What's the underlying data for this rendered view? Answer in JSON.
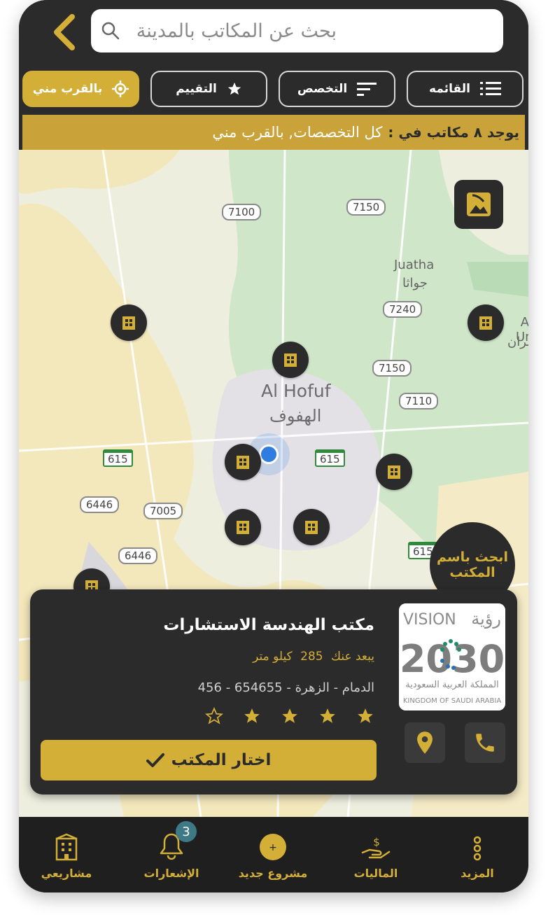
{
  "search": {
    "placeholder": "بحث عن المكاتب بالمدينة"
  },
  "filters": [
    {
      "label": "القائمه"
    },
    {
      "label": "التخصص"
    },
    {
      "label": "التقييم"
    },
    {
      "label": "بالقرب مني"
    }
  ],
  "results": {
    "prefix": "يوجد ٨ مكاتب في :",
    "value": "كل التخصصات, بالقرب مني"
  },
  "map": {
    "search_by_name": "ابحث باسم المكتب",
    "city_en": "Al Hofuf",
    "city_ar": "الهفوف",
    "place_en": "Juatha",
    "place_ar": "جواثا",
    "edge_label_1": "Al Um",
    "edge_label_2": "مران",
    "roads": [
      "7100",
      "7150",
      "7240",
      "7150",
      "7110",
      "615",
      "615",
      "6446",
      "7005",
      "6446",
      "615"
    ]
  },
  "office": {
    "name": "مكتب الهندسة الاستشارات",
    "distance_prefix": "يبعد عنك",
    "distance_value": "285",
    "distance_unit": "كيلو متر",
    "address": "الدمام - الزهرة - 654655 - 456",
    "rating": 4,
    "rating_max": 5,
    "select_label": "اختار المكتب",
    "logo": {
      "vision": "VISION",
      "vision_ar": "رؤية",
      "year": "2030",
      "kingdom_ar": "المملكة العربية السعودية",
      "kingdom_en": "KINGDOM OF SAUDI ARABIA"
    }
  },
  "nav": {
    "projects": "مشاريعي",
    "notifications": "الإشعارات",
    "notifications_count": "3",
    "new_project": "مشروع جديد",
    "finance": "الماليات",
    "more": "المزيد"
  },
  "colors": {
    "gold": "#d4af37",
    "dark": "#2b2b2b",
    "nav": "#1f1f1f"
  }
}
